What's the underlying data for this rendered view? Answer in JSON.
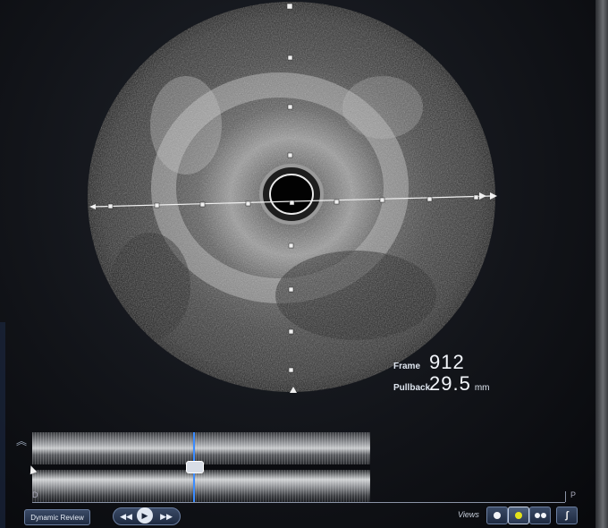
{
  "measurements": {
    "frame_label": "Frame",
    "frame_value": "912",
    "pullback_label": "Pullback",
    "pullback_value": "29.5",
    "pullback_unit": "mm"
  },
  "longitudinal": {
    "distal_label": "D",
    "proximal_label": "P",
    "playhead_position": 0.48
  },
  "controls": {
    "dynamic_review_label": "Dynamic Review",
    "rewind_icon": "◀◀",
    "play_icon": "▶",
    "forward_icon": "▶▶",
    "views_label": "Views",
    "selected_view": 2
  },
  "colors": {
    "playhead": "#3c8cff",
    "selected_view_dot": "#e4e21a"
  }
}
